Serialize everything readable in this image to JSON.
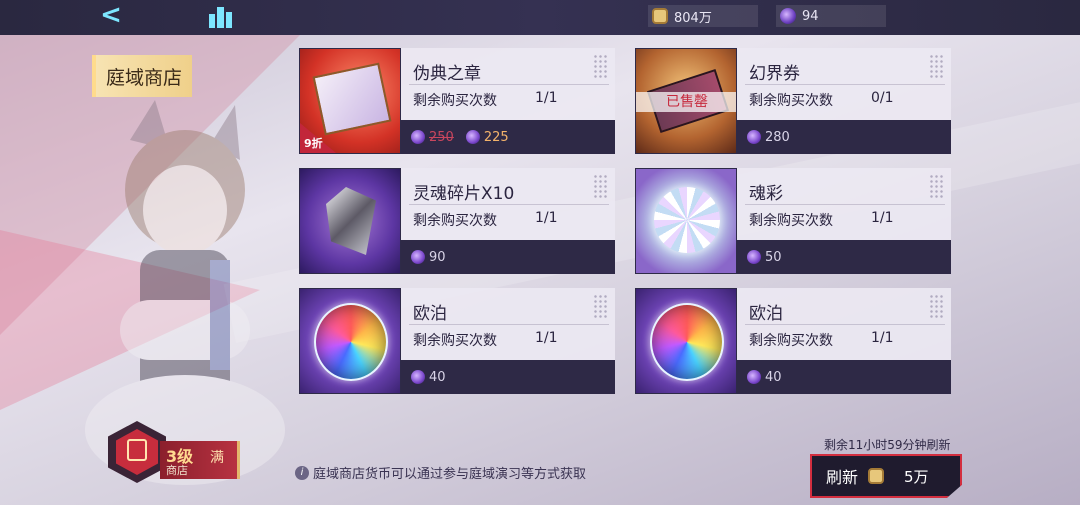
{
  "topbar": {
    "currencies": [
      {
        "name": "gold",
        "value": "804万"
      },
      {
        "name": "gem",
        "value": "94"
      }
    ]
  },
  "shop_tab": {
    "label": "庭域商店"
  },
  "remain_label": "剩余购买次数",
  "items": [
    {
      "name": "伪典之章",
      "remain": "1/1",
      "old_price": "250",
      "price": "225",
      "discount": "9折",
      "sold_out": ""
    },
    {
      "name": "幻界券",
      "remain": "0/1",
      "price": "280",
      "sold_out": "已售罄"
    },
    {
      "name": "灵魂碎片X10",
      "remain": "1/1",
      "price": "90"
    },
    {
      "name": "魂彩",
      "remain": "1/1",
      "price": "50"
    },
    {
      "name": "欧泊",
      "remain": "1/1",
      "price": "40"
    },
    {
      "name": "欧泊",
      "remain": "1/1",
      "price": "40"
    }
  ],
  "level": {
    "level": "3级",
    "sub": "商店",
    "max": "满"
  },
  "hint": "庭域商店货币可以通过参与庭域演习等方式获取",
  "refresh": {
    "time_text": "剩余11小时59分钟刷新",
    "label": "刷新",
    "cost": "5万"
  }
}
